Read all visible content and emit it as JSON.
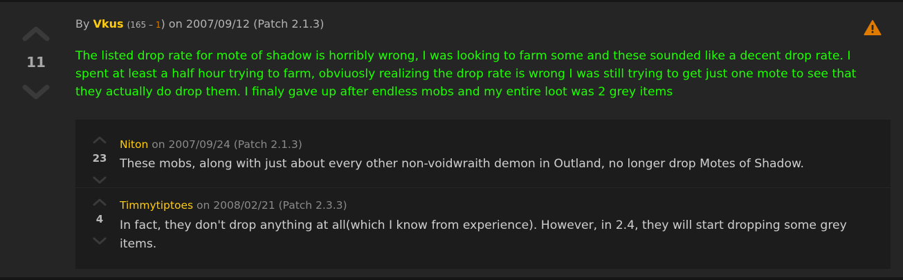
{
  "colors": {
    "background": "#252525",
    "reply_background": "#1c1c1c",
    "username": "#ffcb0f",
    "uncommon_green_text": "#1eff00",
    "vote_arrow": "#3a3a3a",
    "report_icon": "#e07b00"
  },
  "comment": {
    "by_prefix": "By",
    "author": "Vkus",
    "rep_open": "(",
    "rep_positive": "165",
    "rep_sep": " – ",
    "rep_negative": "1",
    "rep_close": ")",
    "date_text": "on 2007/09/12 (Patch 2.1.3)",
    "score": "11",
    "body": "The listed drop rate for mote of shadow is horribly wrong, I was looking to farm some and these sounded like a decent drop rate. I spent at least a half hour trying to farm, obviuosly realizing the drop rate is wrong I was still trying to get just one mote to see that they actually do drop them. I finaly gave up after endless mobs and my entire loot was 2 grey items",
    "upvote_icon": "chevron-up-icon",
    "downvote_icon": "chevron-down-icon",
    "report_icon": "warning-triangle-icon"
  },
  "replies": [
    {
      "author": "Niton",
      "date_text": "on 2007/09/24 (Patch 2.1.3)",
      "score": "23",
      "text": "These mobs, along with just about every other non-voidwraith demon in Outland, no longer drop Motes of Shadow."
    },
    {
      "author": "Timmytiptoes",
      "date_text": "on 2008/02/21 (Patch 2.3.3)",
      "score": "4",
      "text": "In fact, they don't drop anything at all(which I know from experience). However, in 2.4, they will start dropping some grey items."
    }
  ]
}
